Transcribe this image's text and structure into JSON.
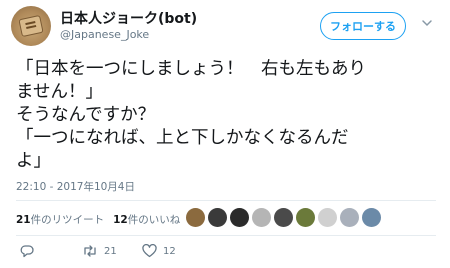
{
  "account": {
    "display_name": "日本人ジョーク(bot)",
    "handle": "@Japanese_Joke",
    "avatar_icon": "shogi-piece-avatar"
  },
  "follow_label": "フォローする",
  "menu_icon": "chevron-down-icon",
  "tweet_lines": [
    "「日本を一つにしましょう！　右も左もあり",
    "ません！」",
    "そうなんですか？",
    "「一つになれば、上と下しかなくなるんだ",
    "よ」"
  ],
  "timestamp": "22:10 - 2017年10月4日",
  "stats": {
    "retweets_count": "21",
    "retweets_label": "件のリツイート",
    "likes_count": "12",
    "likes_label": "件のいいね"
  },
  "liker_colors": [
    "#8b6a3e",
    "#3a3a3a",
    "#2b2b2b",
    "#b5b5b5",
    "#4a4a4a",
    "#6b7a3a",
    "#d0d0d0",
    "#a9b0bb",
    "#6b8aa8"
  ],
  "actions": {
    "reply_count": "",
    "retweet_count": "21",
    "like_count": "12"
  },
  "colors": {
    "accent": "#1da1f2",
    "secondary_text": "#657786",
    "primary_text": "#14171a"
  }
}
